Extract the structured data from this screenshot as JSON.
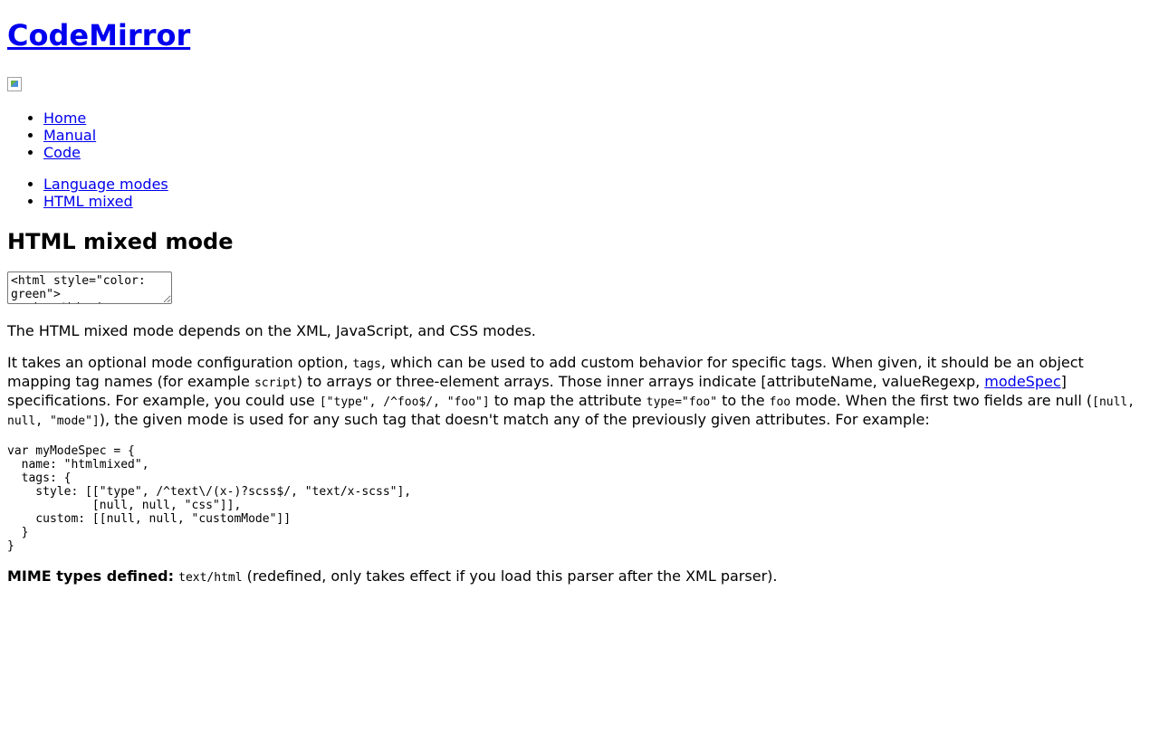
{
  "site": {
    "title": "CodeMirror",
    "logo_alt": "logo-icon"
  },
  "nav": {
    "primary": [
      {
        "label": "Home"
      },
      {
        "label": "Manual"
      },
      {
        "label": "Code"
      }
    ],
    "secondary": [
      {
        "label": "Language modes"
      },
      {
        "label": "HTML mixed"
      }
    ]
  },
  "page": {
    "title": "HTML mixed mode",
    "editor_value": "<html style=\"color: green\">\n  <!-- this is a comment -->\n  <head>\n    <title>Mixed HTML Example</title>",
    "intro": "The HTML mixed mode depends on the XML, JavaScript, and CSS modes.",
    "desc": {
      "t1": "It takes an optional mode configuration option, ",
      "c1": "tags",
      "t2": ", which can be used to add custom behavior for specific tags. When given, it should be an object mapping tag names (for example ",
      "c2": "script",
      "t3": ") to arrays or three-element arrays. Those inner arrays indicate [attributeName, valueRegexp, ",
      "link": "modeSpec",
      "t4": "] specifications. For example, you could use ",
      "c3": "[\"type\", /^foo$/, \"foo\"]",
      "t5": " to map the attribute ",
      "c4": "type=\"foo\"",
      "t6": " to the ",
      "c5": "foo",
      "t7": " mode. When the first two fields are null (",
      "c6": "[null, null, \"mode\"]",
      "t8": "), the given mode is used for any such tag that doesn't match any of the previously given attributes. For example:"
    },
    "example_code": "var myModeSpec = {\n  name: \"htmlmixed\",\n  tags: {\n    style: [[\"type\", /^text\\/(x-)?scss$/, \"text/x-scss\"],\n            [null, null, \"css\"]],\n    custom: [[null, null, \"customMode\"]]\n  }\n}",
    "mime": {
      "label": "MIME types defined:",
      "type": "text/html",
      "note": " (redefined, only takes effect if you load this parser after the XML parser)."
    }
  },
  "colors": {
    "link": "#0000ee",
    "visited": "#551a8b",
    "text": "#000000",
    "background": "#ffffff"
  }
}
